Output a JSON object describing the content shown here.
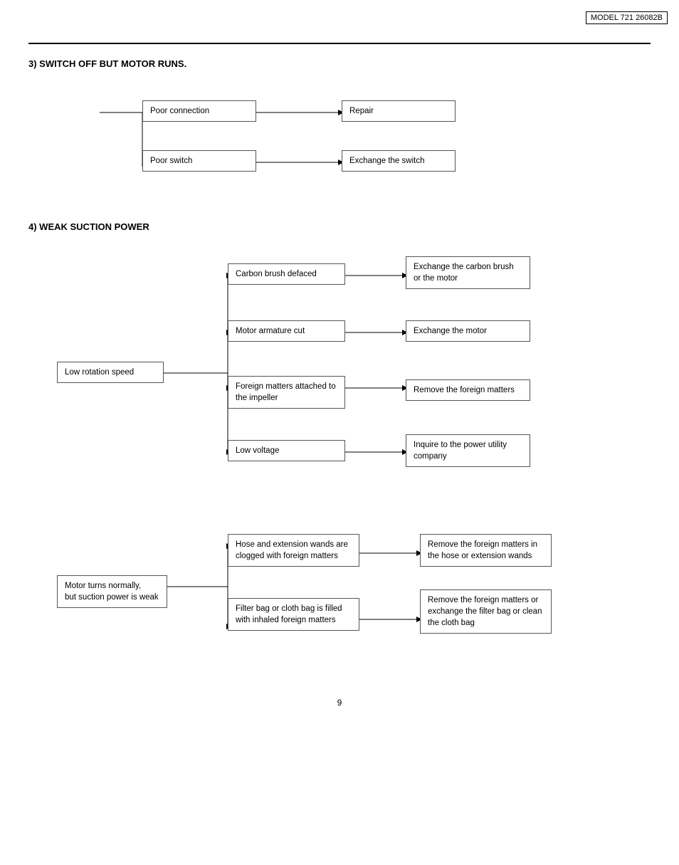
{
  "model_badge": "MODEL 721 26082B",
  "section3": {
    "title": "3) SWITCH OFF BUT MOTOR RUNS.",
    "boxes": {
      "poor_connection": "Poor connection",
      "repair": "Repair",
      "poor_switch": "Poor switch",
      "exchange_switch": "Exchange the switch"
    }
  },
  "section4": {
    "title": "4) WEAK SUCTION POWER",
    "low_rotation": {
      "label": "Low rotation speed"
    },
    "causes": {
      "carbon_brush": "Carbon brush defaced",
      "motor_armature": "Motor armature cut",
      "foreign_impeller": "Foreign matters attached to the impeller",
      "low_voltage": "Low voltage"
    },
    "remedies": {
      "exchange_carbon": "Exchange the carbon brush or the motor",
      "exchange_motor": "Exchange the motor",
      "remove_foreign": "Remove the foreign matters",
      "inquire": "Inquire to the power utility company"
    }
  },
  "section4b": {
    "motor_normal": "Motor turns normally,\nbut suction power is weak",
    "causes": {
      "hose_clogged": "Hose and extension wands are clogged with foreign matters",
      "filter_bag": "Filter bag or cloth bag is filled with inhaled foreign matters"
    },
    "remedies": {
      "remove_hose": "Remove the foreign matters in the hose or extension wands",
      "remove_filter": "Remove the foreign matters or exchange the filter bag or clean the cloth bag"
    }
  },
  "page_number": "9"
}
